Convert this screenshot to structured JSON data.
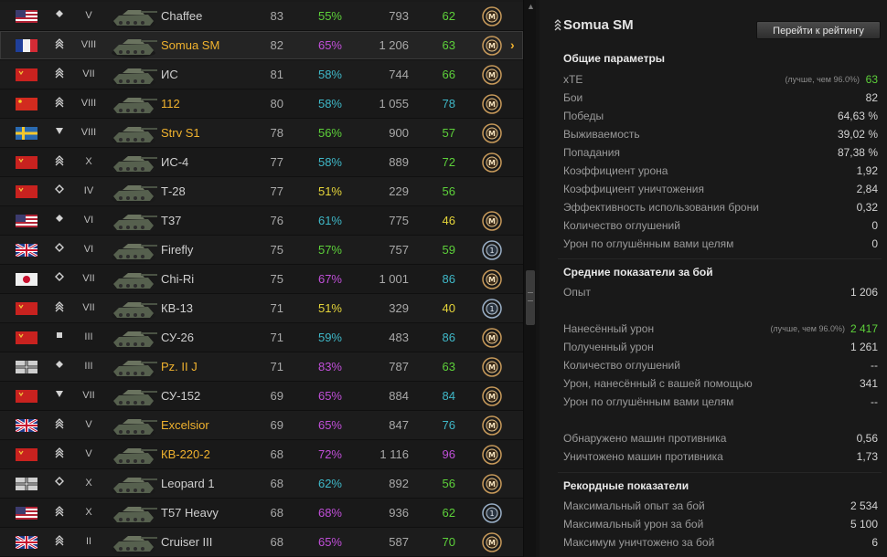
{
  "vehicles": [
    {
      "flag": "usa",
      "cls": "lt",
      "tier": "V",
      "name": "Chaffee",
      "premium": false,
      "battles": "83",
      "winrate": "55%",
      "wr_color": "#5dd13a",
      "damage": "793",
      "xte": "62",
      "xte_color": "#5dd13a",
      "mastery": "M",
      "selected": false
    },
    {
      "flag": "france",
      "cls": "ht",
      "tier": "VIII",
      "name": "Somua SM",
      "premium": true,
      "battles": "82",
      "winrate": "65%",
      "wr_color": "#c04fd8",
      "damage": "1 206",
      "xte": "63",
      "xte_color": "#5dd13a",
      "mastery": "M",
      "selected": true
    },
    {
      "flag": "ussr",
      "cls": "ht",
      "tier": "VII",
      "name": "ИС",
      "premium": false,
      "battles": "81",
      "winrate": "58%",
      "wr_color": "#3fb8c8",
      "damage": "744",
      "xte": "66",
      "xte_color": "#5dd13a",
      "mastery": "M",
      "selected": false
    },
    {
      "flag": "china",
      "cls": "ht",
      "tier": "VIII",
      "name": "112",
      "premium": true,
      "battles": "80",
      "winrate": "58%",
      "wr_color": "#3fb8c8",
      "damage": "1 055",
      "xte": "78",
      "xte_color": "#3fb8c8",
      "mastery": "M",
      "selected": false
    },
    {
      "flag": "sweden",
      "cls": "td",
      "tier": "VIII",
      "name": "Strv S1",
      "premium": true,
      "battles": "78",
      "winrate": "56%",
      "wr_color": "#5dd13a",
      "damage": "900",
      "xte": "57",
      "xte_color": "#5dd13a",
      "mastery": "M",
      "selected": false
    },
    {
      "flag": "ussr",
      "cls": "ht",
      "tier": "X",
      "name": "ИС-4",
      "premium": false,
      "battles": "77",
      "winrate": "58%",
      "wr_color": "#3fb8c8",
      "damage": "889",
      "xte": "72",
      "xte_color": "#5dd13a",
      "mastery": "M",
      "selected": false
    },
    {
      "flag": "ussr",
      "cls": "mt",
      "tier": "IV",
      "name": "Т-28",
      "premium": false,
      "battles": "77",
      "winrate": "51%",
      "wr_color": "#e5d53a",
      "damage": "229",
      "xte": "56",
      "xte_color": "#5dd13a",
      "mastery": "",
      "selected": false
    },
    {
      "flag": "usa",
      "cls": "lt",
      "tier": "VI",
      "name": "T37",
      "premium": false,
      "battles": "76",
      "winrate": "61%",
      "wr_color": "#3fb8c8",
      "damage": "775",
      "xte": "46",
      "xte_color": "#e5d53a",
      "mastery": "M",
      "selected": false
    },
    {
      "flag": "uk",
      "cls": "mt",
      "tier": "VI",
      "name": "Firefly",
      "premium": false,
      "battles": "75",
      "winrate": "57%",
      "wr_color": "#5dd13a",
      "damage": "757",
      "xte": "59",
      "xte_color": "#5dd13a",
      "mastery": "1",
      "selected": false
    },
    {
      "flag": "japan",
      "cls": "mt",
      "tier": "VII",
      "name": "Chi-Ri",
      "premium": false,
      "battles": "75",
      "winrate": "67%",
      "wr_color": "#c04fd8",
      "damage": "1 001",
      "xte": "86",
      "xte_color": "#3fb8c8",
      "mastery": "M",
      "selected": false
    },
    {
      "flag": "ussr",
      "cls": "ht",
      "tier": "VII",
      "name": "КВ-13",
      "premium": false,
      "battles": "71",
      "winrate": "51%",
      "wr_color": "#e5d53a",
      "damage": "329",
      "xte": "40",
      "xte_color": "#e5d53a",
      "mastery": "1",
      "selected": false
    },
    {
      "flag": "ussr",
      "cls": "spg",
      "tier": "III",
      "name": "СУ-26",
      "premium": false,
      "battles": "71",
      "winrate": "59%",
      "wr_color": "#3fb8c8",
      "damage": "483",
      "xte": "86",
      "xte_color": "#3fb8c8",
      "mastery": "M",
      "selected": false
    },
    {
      "flag": "germany",
      "cls": "lt",
      "tier": "III",
      "name": "Pz. II J",
      "premium": true,
      "battles": "71",
      "winrate": "83%",
      "wr_color": "#c04fd8",
      "damage": "787",
      "xte": "63",
      "xte_color": "#5dd13a",
      "mastery": "M",
      "selected": false
    },
    {
      "flag": "ussr",
      "cls": "td",
      "tier": "VII",
      "name": "СУ-152",
      "premium": false,
      "battles": "69",
      "winrate": "65%",
      "wr_color": "#c04fd8",
      "damage": "884",
      "xte": "84",
      "xte_color": "#3fb8c8",
      "mastery": "M",
      "selected": false
    },
    {
      "flag": "uk",
      "cls": "ht",
      "tier": "V",
      "name": "Excelsior",
      "premium": true,
      "battles": "69",
      "winrate": "65%",
      "wr_color": "#c04fd8",
      "damage": "847",
      "xte": "76",
      "xte_color": "#3fb8c8",
      "mastery": "M",
      "selected": false
    },
    {
      "flag": "ussr",
      "cls": "ht",
      "tier": "V",
      "name": "КВ-220-2",
      "premium": true,
      "battles": "68",
      "winrate": "72%",
      "wr_color": "#c04fd8",
      "damage": "1 116",
      "xte": "96",
      "xte_color": "#c04fd8",
      "mastery": "M",
      "selected": false
    },
    {
      "flag": "germany",
      "cls": "mt",
      "tier": "X",
      "name": "Leopard 1",
      "premium": false,
      "battles": "68",
      "winrate": "62%",
      "wr_color": "#3fb8c8",
      "damage": "892",
      "xte": "56",
      "xte_color": "#5dd13a",
      "mastery": "M",
      "selected": false
    },
    {
      "flag": "usa",
      "cls": "ht",
      "tier": "X",
      "name": "T57 Heavy",
      "premium": false,
      "battles": "68",
      "winrate": "68%",
      "wr_color": "#c04fd8",
      "damage": "936",
      "xte": "62",
      "xte_color": "#5dd13a",
      "mastery": "1",
      "selected": false
    },
    {
      "flag": "uk",
      "cls": "ht",
      "tier": "II",
      "name": "Cruiser III",
      "premium": false,
      "battles": "68",
      "winrate": "65%",
      "wr_color": "#c04fd8",
      "damage": "587",
      "xte": "70",
      "xte_color": "#5dd13a",
      "mastery": "M",
      "selected": false
    }
  ],
  "detail": {
    "title": "Somua SM",
    "rating_button": "Перейти к рейтингу",
    "general": {
      "header": "Общие параметры",
      "xte_label": "xTE",
      "xte_note": "(лучше, чем 96.0%)",
      "xte_value": "63",
      "rows": [
        {
          "label": "Бои",
          "value": "82"
        },
        {
          "label": "Победы",
          "value": "64,63 %"
        },
        {
          "label": "Выживаемость",
          "value": "39,02 %"
        },
        {
          "label": "Попадания",
          "value": "87,38 %"
        },
        {
          "label": "Коэффициент урона",
          "value": "1,92"
        },
        {
          "label": "Коэффициент уничтожения",
          "value": "2,84"
        },
        {
          "label": "Эффективность использования брони",
          "value": "0,32"
        },
        {
          "label": "Количество оглушений",
          "value": "0"
        },
        {
          "label": "Урон по оглушённым вами целям",
          "value": "0"
        }
      ]
    },
    "avg": {
      "header": "Средние показатели за бой",
      "exp_label": "Опыт",
      "exp_value": "1 206",
      "dealt_label": "Нанесённый урон",
      "dealt_note": "(лучше, чем 96.0%)",
      "dealt_value": "2 417",
      "rows": [
        {
          "label": "Полученный урон",
          "value": "1 261"
        },
        {
          "label": "Количество оглушений",
          "value": "--"
        },
        {
          "label": "Урон, нанесённый с вашей помощью",
          "value": "341"
        },
        {
          "label": "Урон по оглушённым вами целям",
          "value": "--"
        }
      ],
      "spotted_label": "Обнаружено машин противника",
      "spotted_value": "0,56",
      "killed_label": "Уничтожено машин противника",
      "killed_value": "1,73"
    },
    "records": {
      "header": "Рекордные показатели",
      "rows": [
        {
          "label": "Максимальный опыт за бой",
          "value": "2 534"
        },
        {
          "label": "Максимальный урон за бой",
          "value": "5 100"
        },
        {
          "label": "Максимум уничтожено за бой",
          "value": "6"
        }
      ]
    }
  },
  "colors": {
    "premium": "#f0b22e",
    "good": "#5dd13a",
    "great": "#3fb8c8",
    "unicum": "#c04fd8",
    "average": "#e5d53a"
  }
}
